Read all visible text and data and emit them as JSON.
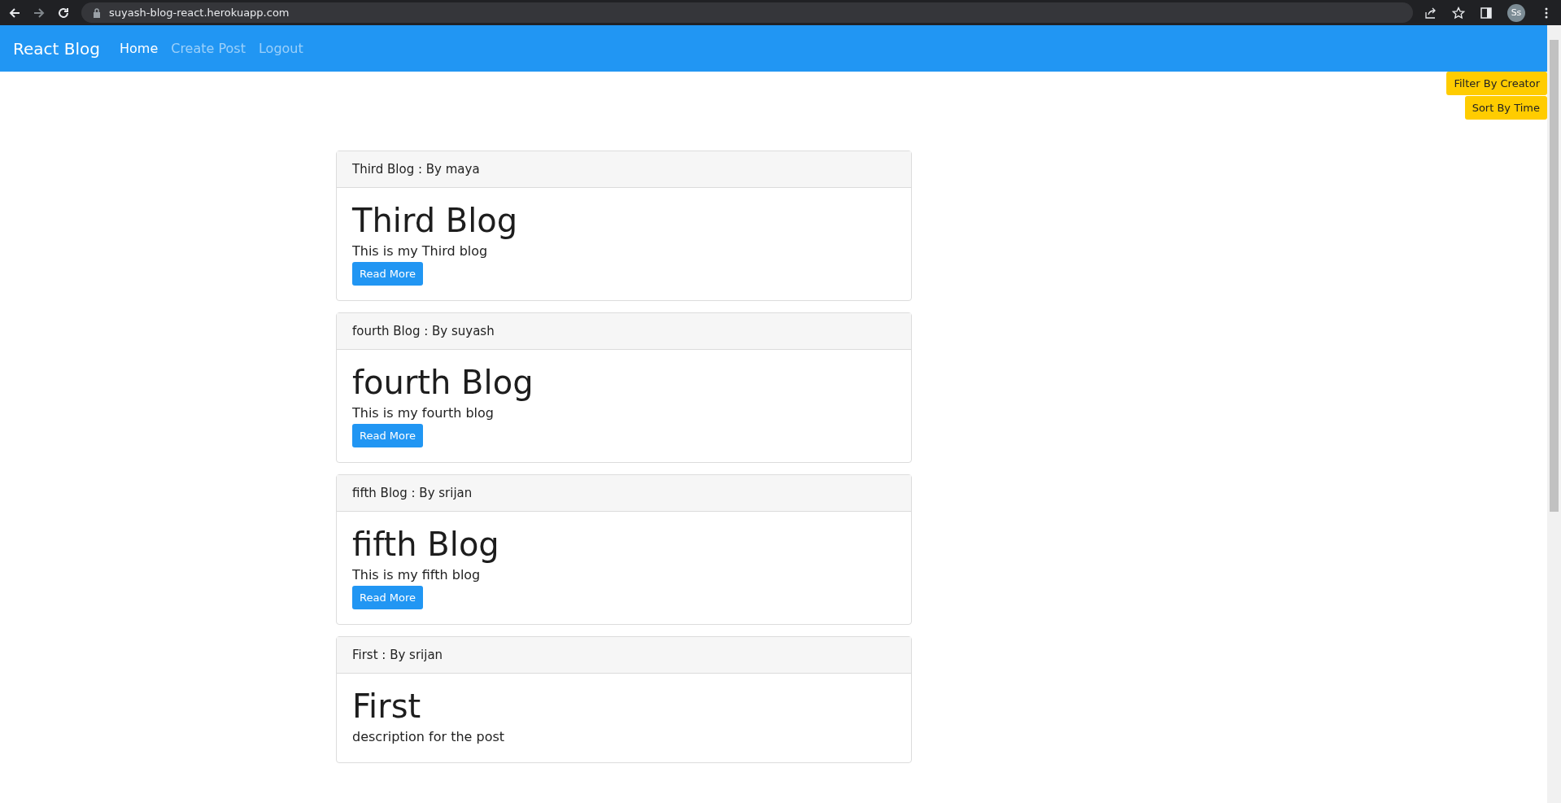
{
  "browser": {
    "url": "suyash-blog-react.herokuapp.com",
    "profile": "Ss"
  },
  "navbar": {
    "brand": "React Blog",
    "links": [
      {
        "label": "Home",
        "selected": true
      },
      {
        "label": "Create Post",
        "selected": false
      },
      {
        "label": "Logout",
        "selected": false
      }
    ]
  },
  "actions": [
    "Filter By Creator",
    "Sort By Time"
  ],
  "posts": [
    {
      "header": "Third Blog : By maya",
      "title": "Third Blog",
      "description": "This is my Third blog",
      "button": "Read More"
    },
    {
      "header": "fourth Blog : By suyash",
      "title": "fourth Blog",
      "description": "This is my fourth blog",
      "button": "Read More"
    },
    {
      "header": "fifth Blog : By srijan",
      "title": "fifth Blog",
      "description": "This is my fifth blog",
      "button": "Read More"
    },
    {
      "header": "First : By srijan",
      "title": "First",
      "description": "description for the post"
    }
  ]
}
